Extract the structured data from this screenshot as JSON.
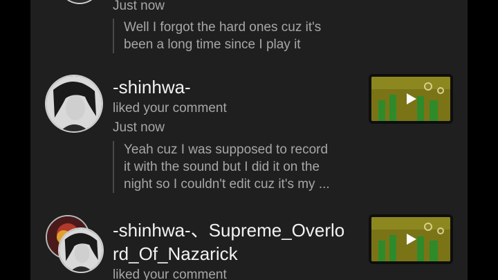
{
  "notifications": [
    {
      "time": "Just now",
      "quote_lines": [
        "Well I forgot the hard ones cuz it's",
        "been a long time since I play it"
      ]
    },
    {
      "username": "-shinhwa-",
      "action": "liked your comment",
      "time": "Just now",
      "quote_lines": [
        "Yeah cuz I was supposed to record",
        "it with the sound but I did it on the",
        "night so I couldn't edit cuz it's my ..."
      ]
    },
    {
      "username_lines": [
        "-shinhwa-、Supreme_Overlo",
        "rd_Of_Nazarick"
      ],
      "action": "liked your comment"
    }
  ],
  "colors": {
    "background": "#1f1f1f",
    "outer": "#000000",
    "text_primary": "#f2f2f2",
    "text_secondary": "#a7a7a7"
  }
}
